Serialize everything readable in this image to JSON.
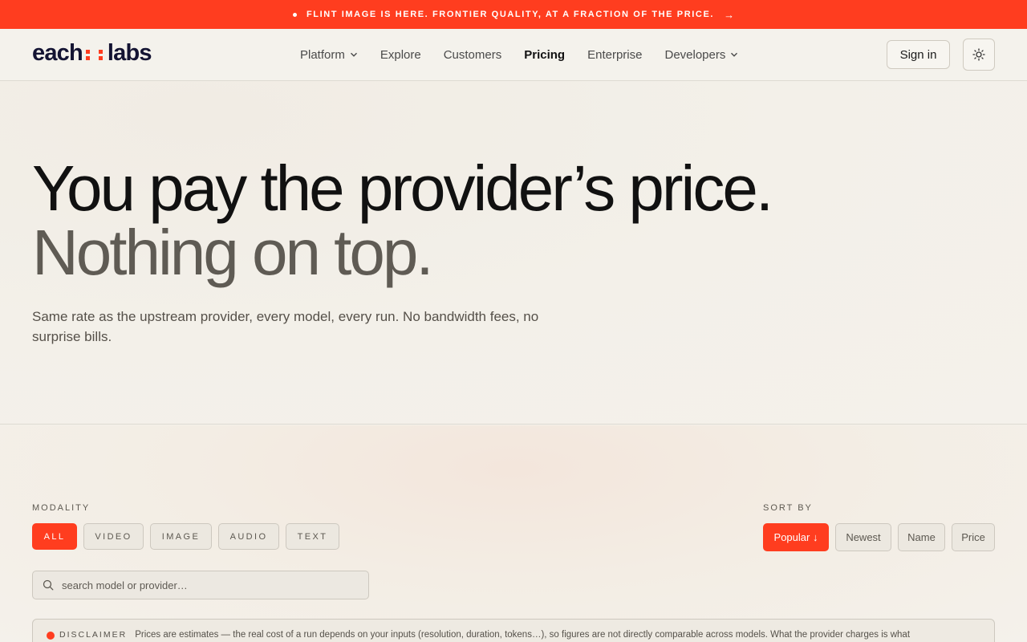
{
  "announcement": {
    "text": "FLINT IMAGE IS HERE. FRONTIER QUALITY, AT A FRACTION OF THE PRICE.",
    "arrow": "→"
  },
  "nav": {
    "logo_left": "each",
    "logo_right": "labs",
    "items": [
      {
        "label": "Platform",
        "dropdown": true
      },
      {
        "label": "Explore",
        "dropdown": false
      },
      {
        "label": "Customers",
        "dropdown": false
      },
      {
        "label": "Pricing",
        "dropdown": false,
        "active": true
      },
      {
        "label": "Enterprise",
        "dropdown": false
      },
      {
        "label": "Developers",
        "dropdown": true
      }
    ],
    "signin": "Sign in",
    "theme_icon": "sun-icon"
  },
  "hero": {
    "headline": "You pay the provider’s price.",
    "headline_muted": "Nothing on top.",
    "subtitle": "Same rate as the upstream provider, every model, every run. No bandwidth fees, no surprise bills."
  },
  "filters": {
    "modality_label": "MODALITY",
    "modalities": [
      "ALL",
      "VIDEO",
      "IMAGE",
      "AUDIO",
      "TEXT"
    ],
    "active_modality": "ALL",
    "sort_label": "SORT BY",
    "sorts": [
      "Popular ↓",
      "Newest",
      "Name",
      "Price"
    ],
    "active_sort": "Popular ↓",
    "search_placeholder": "search model or provider…",
    "disclaimer_tag": "DISCLAIMER",
    "disclaimer_text": "Prices are estimates — the real cost of a run depends on your inputs (resolution, duration, tokens…), so figures are not directly comparable across models. What the provider charges is what"
  },
  "colors": {
    "accent": "#ff3d1f",
    "background": "#f4f1ea",
    "text": "#111111",
    "muted": "#5f5b54"
  }
}
